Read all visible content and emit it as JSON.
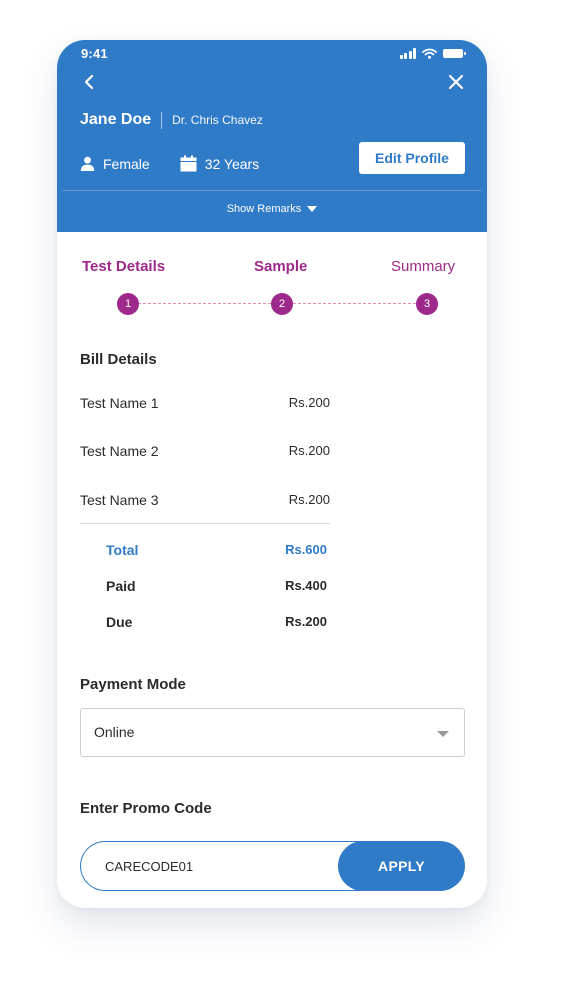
{
  "status_bar": {
    "time": "9:41"
  },
  "patient": {
    "name": "Jane Doe",
    "doctor": "Dr. Chris Chavez",
    "gender": "Female",
    "age": "32 Years"
  },
  "header": {
    "edit_profile_label": "Edit Profile",
    "show_remarks_label": "Show Remarks",
    "background_color": "#2f7bc8"
  },
  "steps": [
    {
      "label": "Test Details",
      "number": "1"
    },
    {
      "label": "Sample",
      "number": "2"
    },
    {
      "label": "Summary",
      "number": "3"
    }
  ],
  "bill": {
    "title": "Bill Details",
    "items": [
      {
        "name": "Test Name 1",
        "amount": "Rs.200"
      },
      {
        "name": "Test Name 2",
        "amount": "Rs.200"
      },
      {
        "name": "Test Name 3",
        "amount": "Rs.200"
      }
    ],
    "total": {
      "label": "Total",
      "amount": "Rs.600"
    },
    "paid": {
      "label": "Paid",
      "amount": "Rs.400"
    },
    "due": {
      "label": "Due",
      "amount": "Rs.200"
    }
  },
  "payment": {
    "title": "Payment Mode",
    "selected": "Online"
  },
  "promo": {
    "title": "Enter Promo Code",
    "value": "CARECODE01",
    "apply_label": "APPLY"
  },
  "colors": {
    "primary": "#2f7bc8",
    "accent": "#9d2a8b"
  },
  "icons": [
    "back-icon",
    "close-icon",
    "person-icon",
    "calendar-icon",
    "caret-down-icon",
    "signal-icon",
    "wifi-icon",
    "battery-icon"
  ]
}
